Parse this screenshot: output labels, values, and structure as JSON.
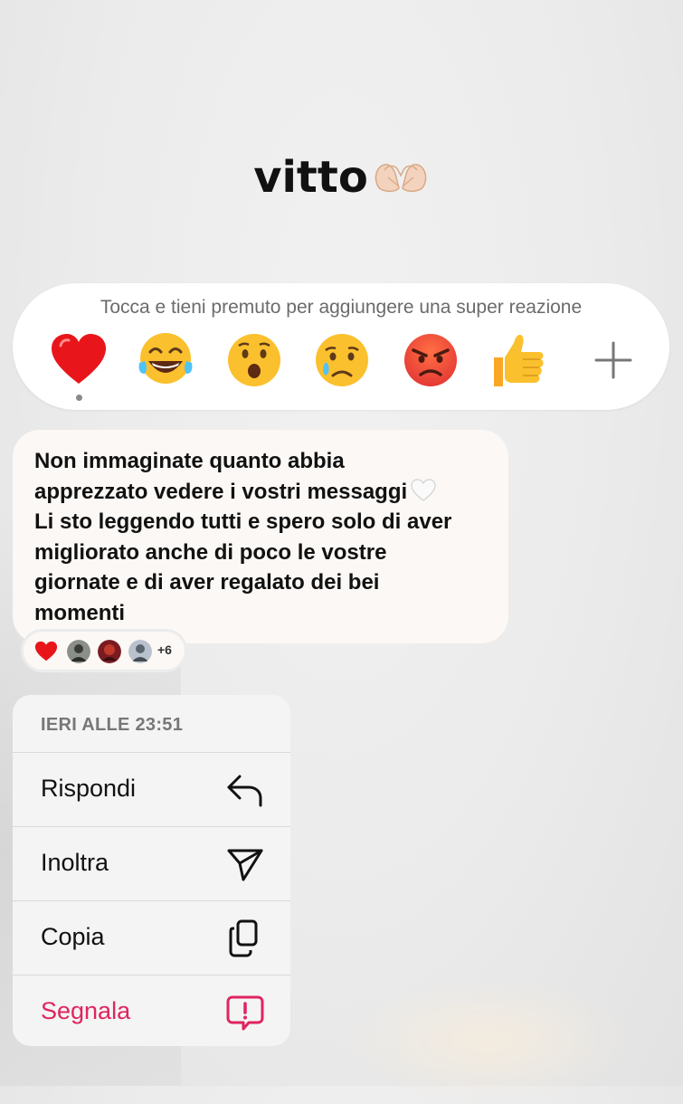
{
  "conversation": {
    "title": "vitto",
    "title_emoji": "heart-hands-emoji"
  },
  "reaction_bar": {
    "hint": "Tocca e tieni premuto per aggiungere una super reazione",
    "emojis": [
      {
        "name": "red-heart",
        "selected": true
      },
      {
        "name": "tears-of-joy"
      },
      {
        "name": "astonished-face"
      },
      {
        "name": "crying-face"
      },
      {
        "name": "angry-face"
      },
      {
        "name": "thumbs-up"
      }
    ],
    "more_icon": "plus-icon"
  },
  "message": {
    "line1": "Non immaginate quanto abbia",
    "line2": "apprezzato vedere i vostri messaggi",
    "line3": "Li sto leggendo tutti e spero solo di aver",
    "line4": "migliorato anche di poco le vostre",
    "line5": "giornate e di aver regalato dei bei",
    "line6": "momenti",
    "inline_emoji": "white-heart"
  },
  "reactions_summary": {
    "emoji": "red-heart",
    "avatars": 3,
    "more_count": "+6"
  },
  "context_menu": {
    "timestamp": "IERI ALLE 23:51",
    "items": [
      {
        "label": "Rispondi",
        "icon": "reply-icon"
      },
      {
        "label": "Inoltra",
        "icon": "send-icon"
      },
      {
        "label": "Copia",
        "icon": "copy-icon"
      },
      {
        "label": "Segnala",
        "icon": "report-icon",
        "danger": true
      }
    ],
    "danger_color": "#e0245e"
  }
}
